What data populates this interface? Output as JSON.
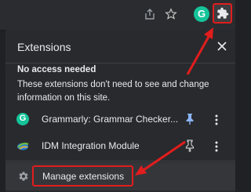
{
  "toolbar": {
    "icons": [
      "share-icon",
      "star-icon",
      "grammarly-icon",
      "puzzle-icon"
    ],
    "grammarly_letter": "G"
  },
  "menu": {
    "title": "Extensions",
    "section_title": "No access needed",
    "section_desc": "These extensions don't need to see and change information on this site.",
    "extensions": [
      {
        "name": "Grammarly: Grammar Checker...",
        "icon": "grammarly-icon",
        "letter": "G",
        "pinned": true
      },
      {
        "name": "IDM Integration Module",
        "icon": "idm-icon",
        "pinned": false
      }
    ],
    "manage_label": "Manage extensions"
  },
  "colors": {
    "background": "#202124",
    "menu_bg": "#292a2d",
    "accent_blue": "#8ab4f8",
    "annotation_red": "#e11d1d",
    "grammarly_green": "#15c39a"
  }
}
